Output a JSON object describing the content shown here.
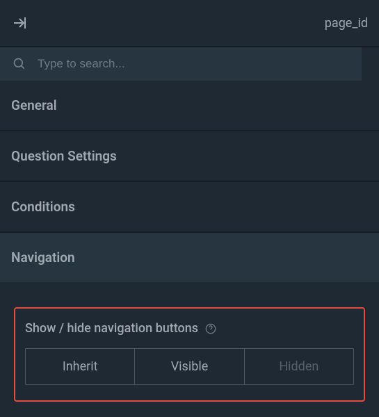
{
  "header": {
    "label": "page_id"
  },
  "search": {
    "placeholder": "Type to search..."
  },
  "sections": {
    "general": "General",
    "question_settings": "Question Settings",
    "conditions": "Conditions",
    "navigation": "Navigation"
  },
  "navigation_setting": {
    "label": "Show / hide navigation buttons",
    "options": {
      "inherit": "Inherit",
      "visible": "Visible",
      "hidden": "Hidden"
    }
  }
}
